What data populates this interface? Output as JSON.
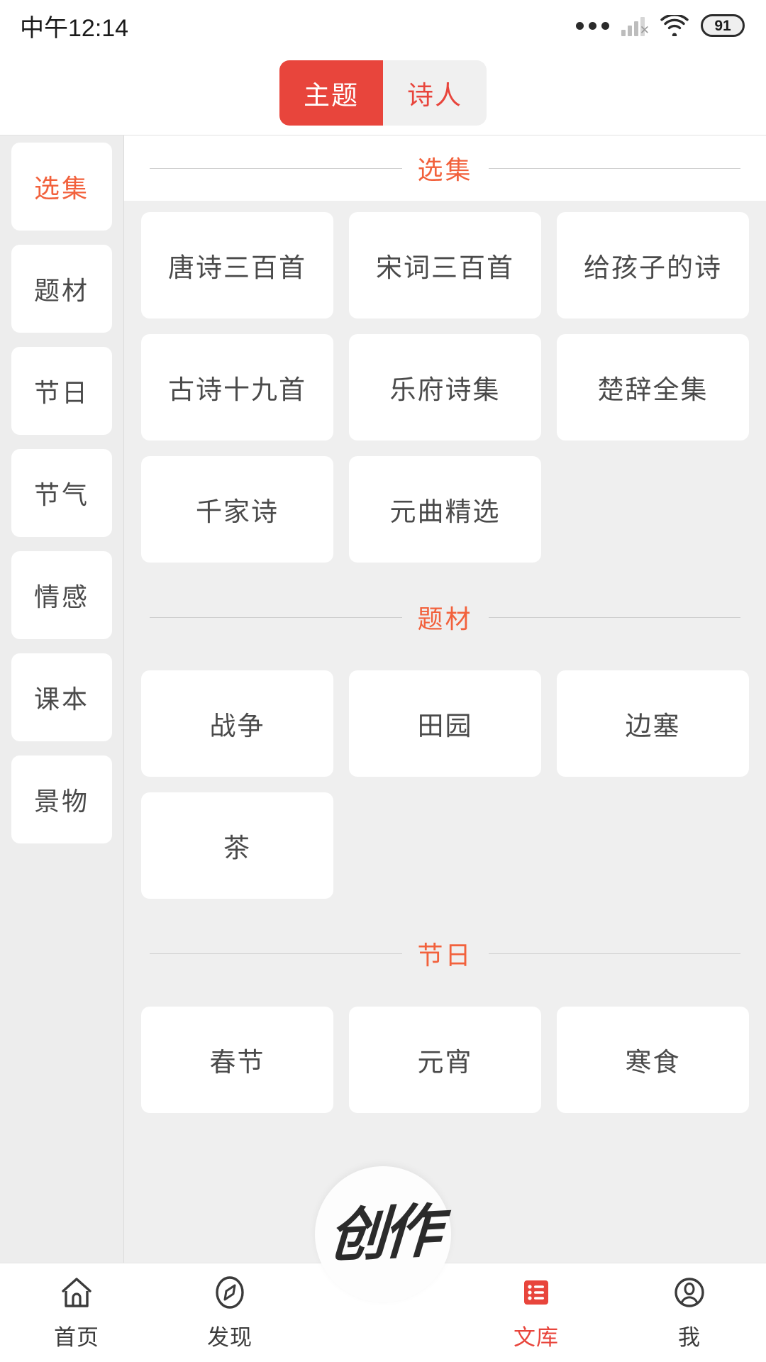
{
  "status_bar": {
    "time": "中午12:14",
    "icons": [
      "more-dots-icon",
      "signal-off-icon",
      "wifi-icon",
      "battery-icon"
    ],
    "battery_level": "91"
  },
  "top_tabs": {
    "items": [
      {
        "label": "主题",
        "active": true
      },
      {
        "label": "诗人",
        "active": false
      }
    ]
  },
  "sidebar": {
    "items": [
      {
        "label": "选集",
        "active": true
      },
      {
        "label": "题材",
        "active": false
      },
      {
        "label": "节日",
        "active": false
      },
      {
        "label": "节气",
        "active": false
      },
      {
        "label": "情感",
        "active": false
      },
      {
        "label": "课本",
        "active": false
      },
      {
        "label": "景物",
        "active": false
      }
    ]
  },
  "main": {
    "sections": [
      {
        "title": "选集",
        "cards": [
          "唐诗三百首",
          "宋词三百首",
          "给孩子的诗",
          "古诗十九首",
          "乐府诗集",
          "楚辞全集",
          "千家诗",
          "元曲精选"
        ]
      },
      {
        "title": "题材",
        "cards": [
          "战争",
          "田园",
          "边塞",
          "茶"
        ]
      },
      {
        "title": "节日",
        "cards": [
          "春节",
          "元宵",
          "寒食"
        ]
      }
    ]
  },
  "fab": {
    "label": "创作",
    "icon": "create-fab"
  },
  "bottom_nav": {
    "items": [
      {
        "label": "首页",
        "icon": "home-icon",
        "active": false
      },
      {
        "label": "发现",
        "icon": "compass-icon",
        "active": false
      },
      {
        "label": "文库",
        "icon": "library-list-icon",
        "active": true
      },
      {
        "label": "我",
        "icon": "profile-icon",
        "active": false
      }
    ]
  },
  "colors": {
    "accent_red": "#E8453C",
    "accent_orange": "#F2613C",
    "page_bg": "#EFEFEF",
    "card_bg": "#FFFFFF",
    "text_primary": "#4A4A4A"
  }
}
